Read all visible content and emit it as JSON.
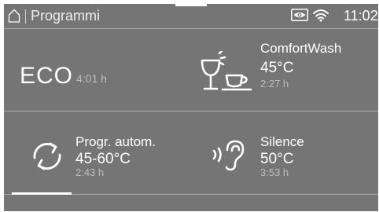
{
  "status_bar": {
    "title": "Programmi",
    "time": "11:02",
    "icons": [
      "home-icon",
      "eye-icon",
      "wifi-icon"
    ]
  },
  "programs": [
    {
      "name": "ECO",
      "duration": "4:01   h",
      "icon": ""
    },
    {
      "name": "ComfortWash",
      "temperature": "45°C",
      "duration": "2:27   h",
      "icon": "glass-cup-icon"
    },
    {
      "name": "Progr. autom.",
      "temperature": "45-60°C",
      "duration": "2:43   h",
      "icon": "cycle-icon"
    },
    {
      "name": "Silence",
      "temperature": "50°C",
      "duration": "3:53   h",
      "icon": "silence-icon"
    }
  ],
  "pager": {
    "current_page": 1
  },
  "colors": {
    "background": "#757575",
    "text": "#ffffff",
    "secondary_text": "#bdbdbd",
    "divider": "#aaaaaa"
  }
}
